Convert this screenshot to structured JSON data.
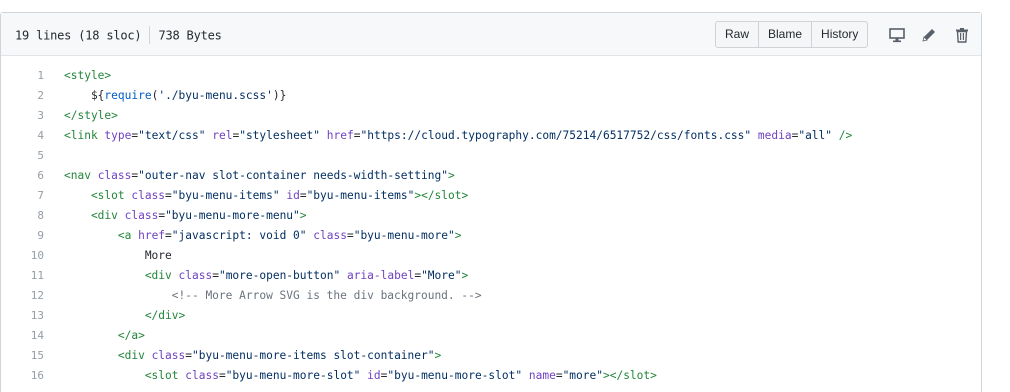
{
  "file_header": {
    "lines_info": "19 lines (18 sloc)",
    "size": "738 Bytes",
    "buttons": {
      "raw": "Raw",
      "blame": "Blame",
      "history": "History"
    },
    "icons": [
      "desktop-icon",
      "pencil-icon",
      "trash-icon"
    ]
  },
  "code": {
    "line_numbers": [
      "1",
      "2",
      "3",
      "4",
      "5",
      "6",
      "7",
      "8",
      "9",
      "10",
      "11",
      "12",
      "13",
      "14",
      "15",
      "16"
    ],
    "lines": [
      [
        [
          "t",
          "<style>"
        ]
      ],
      [
        [
          "",
          "    ${"
        ],
        [
          "f",
          "require"
        ],
        [
          "",
          "("
        ],
        [
          "s",
          "'./byu-menu.scss'"
        ],
        [
          "",
          ")}"
        ]
      ],
      [
        [
          "t",
          "</style>"
        ]
      ],
      [
        [
          "t",
          "<link "
        ],
        [
          "a",
          "type"
        ],
        [
          "",
          "="
        ],
        [
          "s",
          "\"text/css\""
        ],
        [
          "",
          " "
        ],
        [
          "a",
          "rel"
        ],
        [
          "",
          "="
        ],
        [
          "s",
          "\"stylesheet\""
        ],
        [
          "",
          " "
        ],
        [
          "a",
          "href"
        ],
        [
          "",
          "="
        ],
        [
          "s",
          "\"https://cloud.typography.com/75214/6517752/css/fonts.css\""
        ],
        [
          "",
          " "
        ],
        [
          "a",
          "media"
        ],
        [
          "",
          "="
        ],
        [
          "s",
          "\"all\""
        ],
        [
          "t",
          " />"
        ]
      ],
      [
        [
          "",
          ""
        ]
      ],
      [
        [
          "t",
          "<nav "
        ],
        [
          "a",
          "class"
        ],
        [
          "",
          "="
        ],
        [
          "s",
          "\"outer-nav slot-container needs-width-setting\""
        ],
        [
          "t",
          ">"
        ]
      ],
      [
        [
          "t",
          "    <slot "
        ],
        [
          "a",
          "class"
        ],
        [
          "",
          "="
        ],
        [
          "s",
          "\"byu-menu-items\""
        ],
        [
          "",
          " "
        ],
        [
          "a",
          "id"
        ],
        [
          "",
          "="
        ],
        [
          "s",
          "\"byu-menu-items\""
        ],
        [
          "t",
          "></slot>"
        ]
      ],
      [
        [
          "t",
          "    <div "
        ],
        [
          "a",
          "class"
        ],
        [
          "",
          "="
        ],
        [
          "s",
          "\"byu-menu-more-menu\""
        ],
        [
          "t",
          ">"
        ]
      ],
      [
        [
          "t",
          "        <a "
        ],
        [
          "a",
          "href"
        ],
        [
          "",
          "="
        ],
        [
          "s",
          "\"javascript: void 0\""
        ],
        [
          "",
          " "
        ],
        [
          "a",
          "class"
        ],
        [
          "",
          "="
        ],
        [
          "s",
          "\"byu-menu-more\""
        ],
        [
          "t",
          ">"
        ]
      ],
      [
        [
          "",
          "            More"
        ]
      ],
      [
        [
          "t",
          "            <div "
        ],
        [
          "a",
          "class"
        ],
        [
          "",
          "="
        ],
        [
          "s",
          "\"more-open-button\""
        ],
        [
          "",
          " "
        ],
        [
          "a",
          "aria-label"
        ],
        [
          "",
          "="
        ],
        [
          "s",
          "\"More\""
        ],
        [
          "t",
          ">"
        ]
      ],
      [
        [
          "c",
          "                <!-- More Arrow SVG is the div background. -->"
        ]
      ],
      [
        [
          "t",
          "            </div>"
        ]
      ],
      [
        [
          "t",
          "        </a>"
        ]
      ],
      [
        [
          "t",
          "        <div "
        ],
        [
          "a",
          "class"
        ],
        [
          "",
          "="
        ],
        [
          "s",
          "\"byu-menu-more-items slot-container\""
        ],
        [
          "t",
          ">"
        ]
      ],
      [
        [
          "t",
          "            <slot "
        ],
        [
          "a",
          "class"
        ],
        [
          "",
          "="
        ],
        [
          "s",
          "\"byu-menu-more-slot\""
        ],
        [
          "",
          " "
        ],
        [
          "a",
          "id"
        ],
        [
          "",
          "="
        ],
        [
          "s",
          "\"byu-menu-more-slot\""
        ],
        [
          "",
          " "
        ],
        [
          "a",
          "name"
        ],
        [
          "",
          "="
        ],
        [
          "s",
          "\"more\""
        ],
        [
          "t",
          "></slot>"
        ]
      ]
    ]
  }
}
